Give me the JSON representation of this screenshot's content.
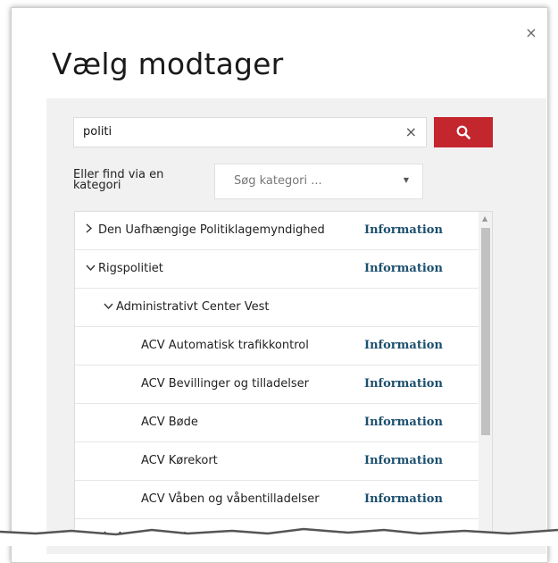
{
  "dialog": {
    "title": "Vælg modtager",
    "close_label": "×"
  },
  "search": {
    "value": "politi",
    "clear_label": "×",
    "button_icon": "search-icon"
  },
  "category": {
    "label": "Eller find via en kategori",
    "placeholder": "Søg kategori ...",
    "caret": "▼"
  },
  "results": {
    "info_label": "Information",
    "rows": [
      {
        "name": "Den Uafhængige Politiklagemyndighed",
        "indent": 0,
        "toggle": "collapsed",
        "has_info": true
      },
      {
        "name": "Rigspolitiet",
        "indent": 0,
        "toggle": "expanded",
        "has_info": true
      },
      {
        "name": "Administrativt Center Vest",
        "indent": 1,
        "toggle": "expanded",
        "has_info": false
      },
      {
        "name": "ACV Automatisk trafikkontrol",
        "indent": 2,
        "toggle": "none",
        "has_info": true
      },
      {
        "name": "ACV Bevillinger og tilladelser",
        "indent": 2,
        "toggle": "none",
        "has_info": true
      },
      {
        "name": "ACV Bøde",
        "indent": 2,
        "toggle": "none",
        "has_info": true
      },
      {
        "name": "ACV Kørekort",
        "indent": 2,
        "toggle": "none",
        "has_info": true
      },
      {
        "name": "ACV Våben og våbentilladelser",
        "indent": 2,
        "toggle": "none",
        "has_info": true
      },
      {
        "name": "Administrativt Center Øst",
        "indent": 1,
        "toggle": "collapsed",
        "has_info": false
      }
    ]
  },
  "colors": {
    "accent_red": "#c4262e",
    "info_blue": "#1c4f6e",
    "panel_gray": "#f1f1f1"
  }
}
